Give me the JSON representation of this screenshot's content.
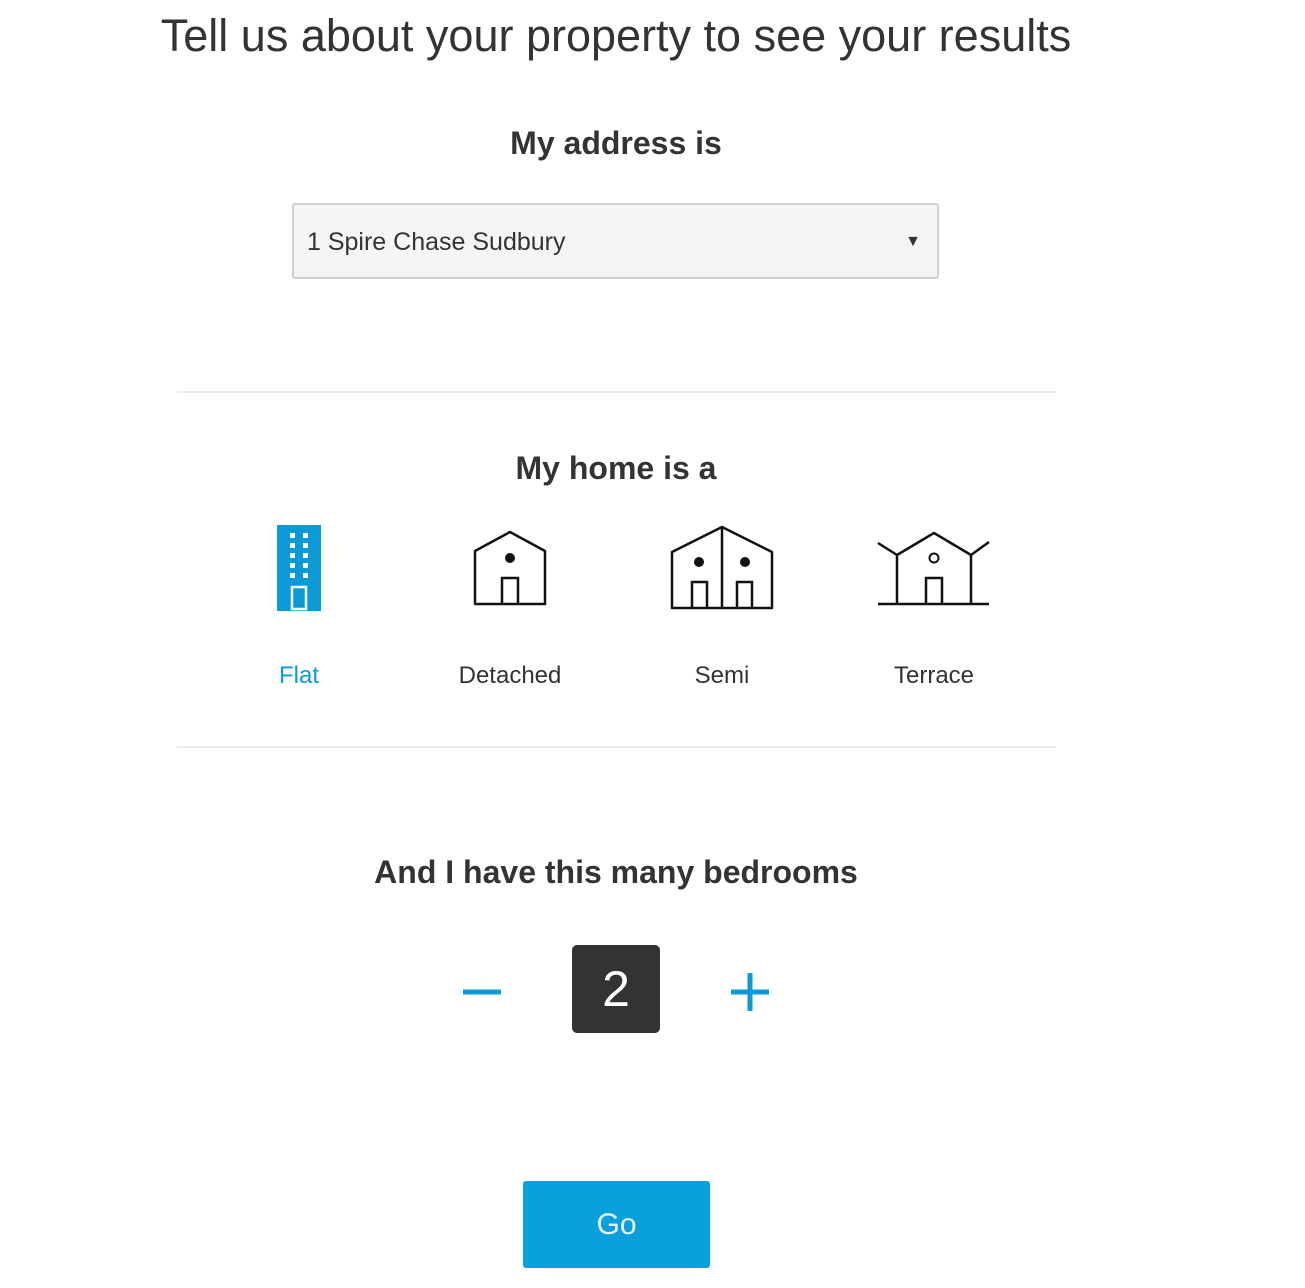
{
  "header": {
    "title": "Tell us about your property to see your results"
  },
  "address": {
    "heading": "My address is",
    "selected": "1 Spire Chase Sudbury",
    "arrow": "▼"
  },
  "home_type": {
    "heading": "My home is a",
    "options": [
      {
        "label": "Flat",
        "icon": "flat-building-icon",
        "selected": true
      },
      {
        "label": "Detached",
        "icon": "detached-house-icon",
        "selected": false
      },
      {
        "label": "Semi",
        "icon": "semi-detached-house-icon",
        "selected": false
      },
      {
        "label": "Terrace",
        "icon": "terrace-house-icon",
        "selected": false
      }
    ]
  },
  "bedrooms": {
    "heading": "And I have this many bedrooms",
    "count": "2",
    "minus_icon": "minus-icon",
    "plus_icon": "plus-icon"
  },
  "actions": {
    "go_label": "Go"
  },
  "colors": {
    "accent": "#0aa0dc",
    "text": "#333333",
    "count_background": "#333333"
  }
}
